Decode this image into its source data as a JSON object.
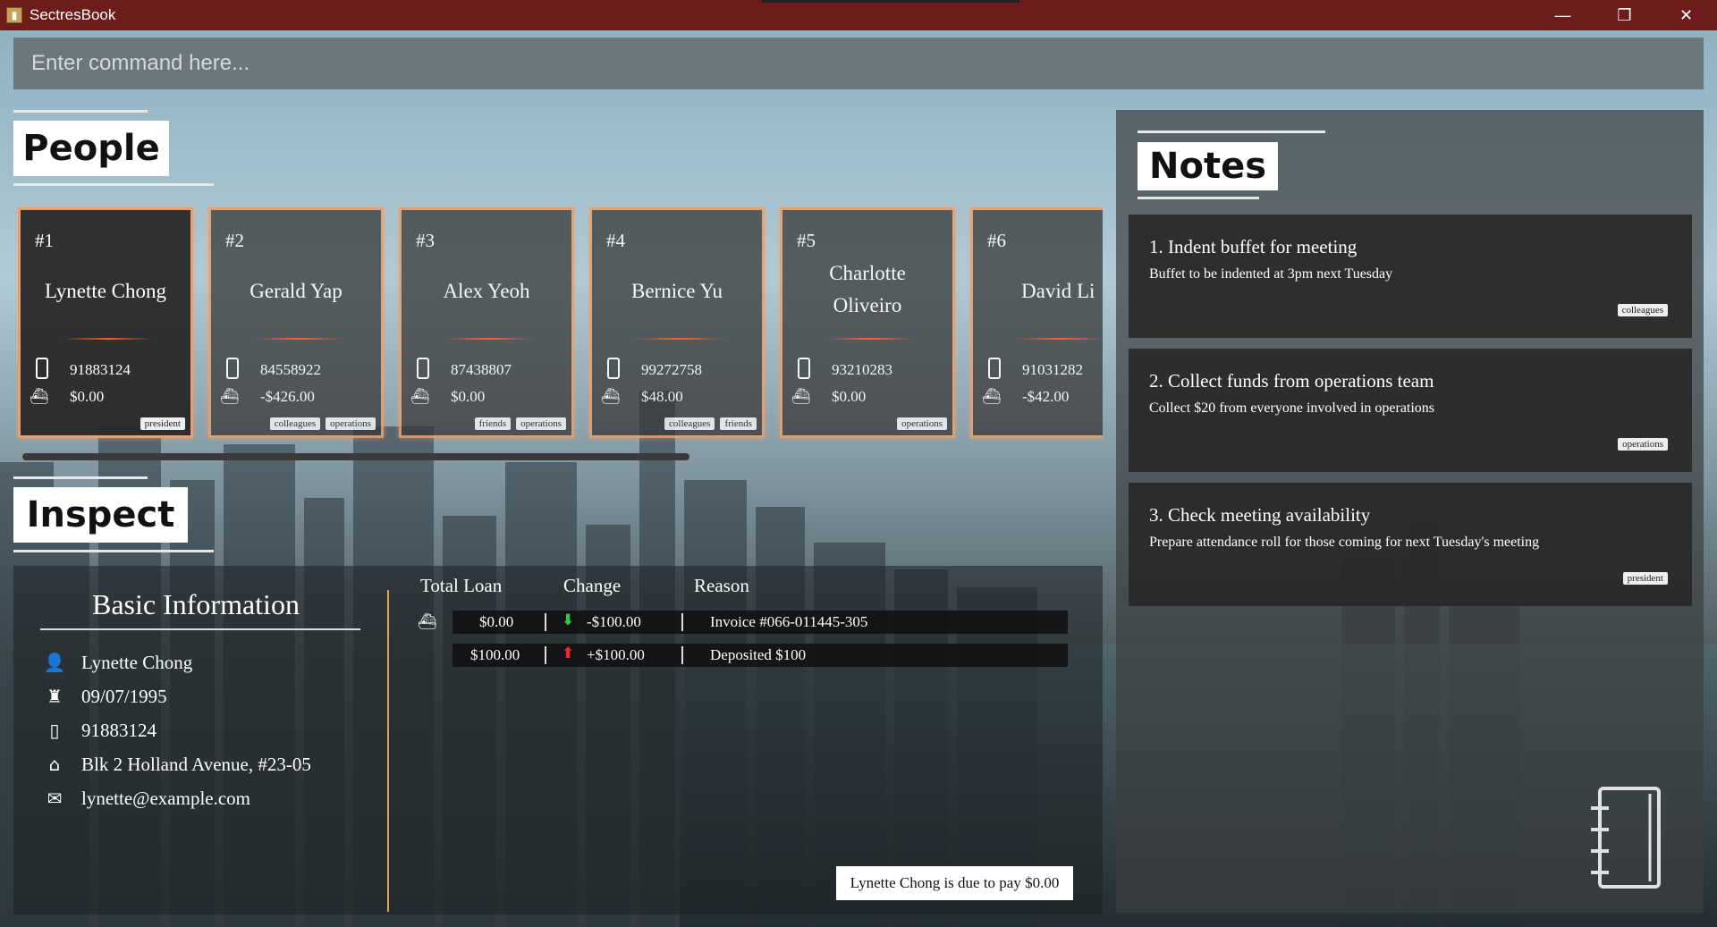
{
  "window": {
    "title": "SectresBook",
    "minimize": "—",
    "restore": "❐",
    "close": "✕"
  },
  "command": {
    "placeholder": "Enter command here..."
  },
  "people_section": {
    "title": "People"
  },
  "people": [
    {
      "num": "#1",
      "name": "Lynette Chong",
      "phone": "91883124",
      "money": "$0.00",
      "tags": [
        "president"
      ]
    },
    {
      "num": "#2",
      "name": "Gerald Yap",
      "phone": "84558922",
      "money": "-$426.00",
      "tags": [
        "colleagues",
        "operations"
      ]
    },
    {
      "num": "#3",
      "name": "Alex Yeoh",
      "phone": "87438807",
      "money": "$0.00",
      "tags": [
        "friends",
        "operations"
      ]
    },
    {
      "num": "#4",
      "name": "Bernice Yu",
      "phone": "99272758",
      "money": "$48.00",
      "tags": [
        "colleagues",
        "friends"
      ]
    },
    {
      "num": "#5",
      "name": "Charlotte Oliveiro",
      "phone": "93210283",
      "money": "$0.00",
      "tags": [
        "operations"
      ]
    },
    {
      "num": "#6",
      "name": "David Li",
      "phone": "91031282",
      "money": "-$42.00",
      "tags": []
    }
  ],
  "inspect_section": {
    "title": "Inspect"
  },
  "basic_info": {
    "title": "Basic Information",
    "name": "Lynette Chong",
    "birthday": "09/07/1995",
    "phone": "91883124",
    "address": "Blk 2 Holland Avenue, #23-05",
    "email": "lynette@example.com"
  },
  "transactions": {
    "headers": {
      "total": "Total Loan",
      "change": "Change",
      "reason": "Reason"
    },
    "rows": [
      {
        "total": "$0.00",
        "direction": "down",
        "change": "-$100.00",
        "reason": "Invoice #066-011445-305"
      },
      {
        "total": "$100.00",
        "direction": "up",
        "change": "+$100.00",
        "reason": "Deposited $100"
      }
    ]
  },
  "due_message": "Lynette Chong is due to pay $0.00",
  "notes_section": {
    "title": "Notes"
  },
  "notes": [
    {
      "title": "1.  Indent buffet for meeting",
      "text": "Buffet to be indented at 3pm next Tuesday",
      "tag": "colleagues"
    },
    {
      "title": "2.  Collect funds from operations team",
      "text": "Collect $20 from everyone involved in operations",
      "tag": "operations"
    },
    {
      "title": "3.  Check meeting availability",
      "text": "Prepare attendance roll for those coming for next Tuesday's meeting",
      "tag": "president"
    }
  ],
  "colors": {
    "titlebar": "#6e1b1b",
    "card_border": "#e8a070",
    "accent_orange": "#ff5a1e",
    "change_down": "#2ecc40",
    "change_up": "#ff2020",
    "divider": "#e8a040"
  }
}
